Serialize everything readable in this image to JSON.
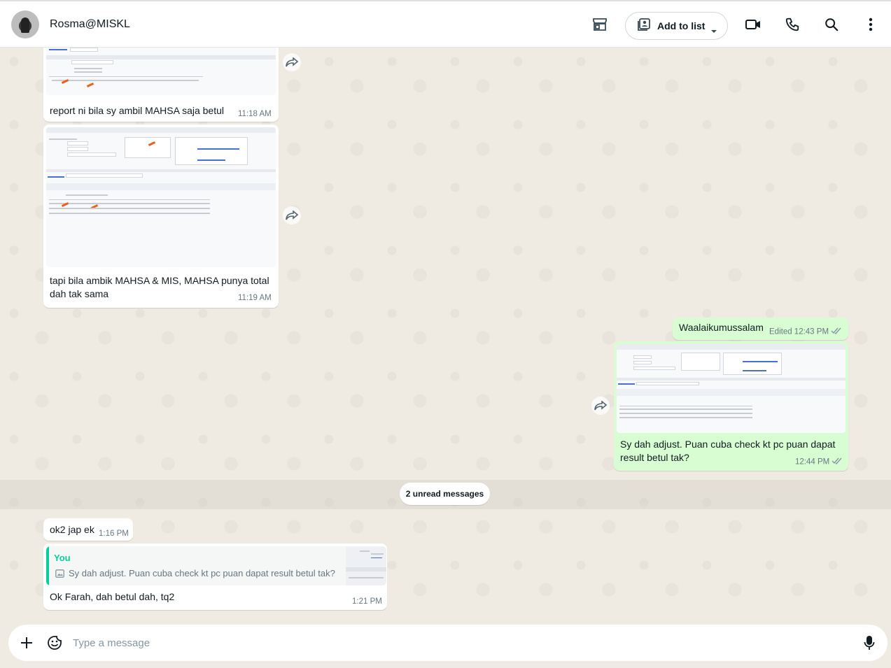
{
  "header": {
    "contact_name": "Rosma@MISKL",
    "add_to_list_label": "Add to list",
    "icons": [
      "store-icon",
      "video-call-icon",
      "voice-call-icon",
      "search-icon",
      "menu-icon"
    ]
  },
  "messages": {
    "m1": {
      "text": "report ni bila sy ambil MAHSA saja betul",
      "time": "11:18 AM"
    },
    "m2": {
      "text": "tapi bila ambik MAHSA & MIS, MAHSA punya total dah tak sama",
      "time": "11:19 AM"
    },
    "m3": {
      "text": "Waalaikumussalam",
      "status": "Edited 12:43 PM"
    },
    "m4": {
      "text": "Sy dah adjust. Puan cuba check kt pc puan dapat result betul tak?",
      "time": "12:44 PM"
    },
    "unread": "2 unread messages",
    "m5": {
      "text": "ok2 jap ek",
      "time": "1:16 PM"
    },
    "m6": {
      "quote_author": "You",
      "quote_text": "Sy dah adjust. Puan cuba check kt pc puan dapat result betul tak?",
      "text": "Ok Farah, dah betul dah, tq2",
      "time": "1:21 PM"
    }
  },
  "composer": {
    "placeholder": "Type a message"
  },
  "colors": {
    "outgoing_bubble": "#d9fdd3",
    "incoming_bubble": "#ffffff",
    "chat_bg": "#efeae2",
    "accent": "#06cf9c",
    "read_ticks": "#53bdeb"
  }
}
